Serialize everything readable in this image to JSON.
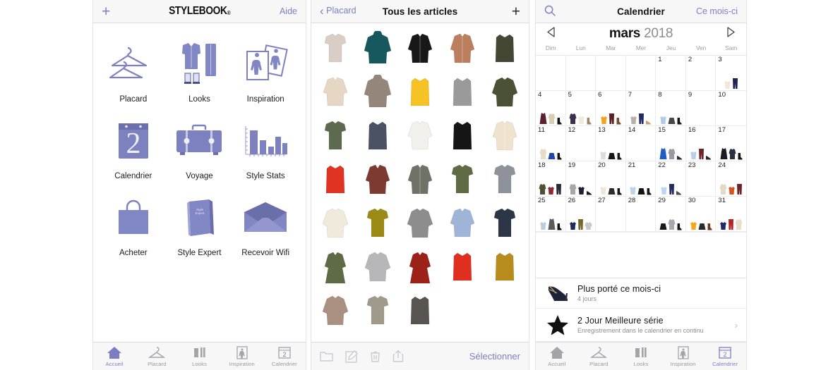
{
  "accent": "#7b7fc2",
  "home_panel": {
    "navbar": {
      "add_icon": "plus-icon",
      "title": "STYLEBOOK",
      "title_mark": "®",
      "help_label": "Aide"
    },
    "tiles": [
      {
        "label": "Placard",
        "icon": "hangers-icon"
      },
      {
        "label": "Looks",
        "icon": "outfit-icon"
      },
      {
        "label": "Inspiration",
        "icon": "photos-icon"
      },
      {
        "label": "Calendrier",
        "icon": "calendar-icon"
      },
      {
        "label": "Voyage",
        "icon": "suitcase-icon"
      },
      {
        "label": "Style Stats",
        "icon": "bar-chart-icon"
      },
      {
        "label": "Acheter",
        "icon": "shopping-bag-icon"
      },
      {
        "label": "Style Expert",
        "icon": "book-icon"
      },
      {
        "label": "Recevoir Wifi",
        "icon": "envelope-icon"
      }
    ],
    "tabbar": {
      "active": "Accueil",
      "items": [
        {
          "label": "Accueil",
          "icon": "home-icon"
        },
        {
          "label": "Placard",
          "icon": "hanger-icon"
        },
        {
          "label": "Looks",
          "icon": "outfit-icon"
        },
        {
          "label": "Inspiration",
          "icon": "inspiration-icon"
        },
        {
          "label": "Calendrier",
          "icon": "calendar-icon"
        }
      ]
    }
  },
  "closet_panel": {
    "navbar": {
      "back_label": "Placard",
      "back_icon": "chevron-left-icon",
      "title": "Tous les articles",
      "add_icon": "plus-icon"
    },
    "items": [
      {
        "type": "tee",
        "color": "#d9cdc6"
      },
      {
        "type": "hoodie",
        "color": "#17585e"
      },
      {
        "type": "cardigan",
        "color": "#181818"
      },
      {
        "type": "cardigan",
        "color": "#bb7f5d"
      },
      {
        "type": "tank",
        "color": "#434734"
      },
      {
        "type": "blouse",
        "color": "#e6d6c4"
      },
      {
        "type": "hoodie",
        "color": "#95867c"
      },
      {
        "type": "tank",
        "color": "#f5c324"
      },
      {
        "type": "tank",
        "color": "#9a9a9a"
      },
      {
        "type": "sweater",
        "color": "#4a5135"
      },
      {
        "type": "tee",
        "color": "#5e6a4f"
      },
      {
        "type": "tank",
        "color": "#4a5263"
      },
      {
        "type": "blouse",
        "color": "#f2f0ea"
      },
      {
        "type": "tank",
        "color": "#151515"
      },
      {
        "type": "cardigan",
        "color": "#efe3cd"
      },
      {
        "type": "tank",
        "color": "#e03322"
      },
      {
        "type": "shirt",
        "color": "#7c3a30"
      },
      {
        "type": "cardigan",
        "color": "#6f7266"
      },
      {
        "type": "tee",
        "color": "#5f6b44"
      },
      {
        "type": "tee",
        "color": "#8e929a"
      },
      {
        "type": "sweater",
        "color": "#efeadc"
      },
      {
        "type": "tee",
        "color": "#9b8a16"
      },
      {
        "type": "sweater",
        "color": "#8d8d8d"
      },
      {
        "type": "blouse",
        "color": "#9fb4d6"
      },
      {
        "type": "tee",
        "color": "#2d3646"
      },
      {
        "type": "dress",
        "color": "#5e6b45"
      },
      {
        "type": "sweater",
        "color": "#b7b7ba"
      },
      {
        "type": "dress",
        "color": "#9c2219"
      },
      {
        "type": "tank",
        "color": "#df2f1f"
      },
      {
        "type": "tank",
        "color": "#b78b1c"
      },
      {
        "type": "sweater",
        "color": "#a99080"
      },
      {
        "type": "tee",
        "color": "#a09a8c"
      },
      {
        "type": "tank",
        "color": "#585450"
      }
    ],
    "toolbar": {
      "icons": [
        "folder-icon",
        "edit-icon",
        "trash-icon",
        "share-icon"
      ],
      "select_label": "Sélectionner"
    }
  },
  "calendar_panel": {
    "navbar": {
      "search_icon": "search-icon",
      "title": "Calendrier",
      "this_month_label": "Ce mois-ci"
    },
    "month": {
      "name": "mars",
      "year": "2018",
      "prev_icon": "triangle-left-icon",
      "next_icon": "triangle-right-icon"
    },
    "weekdays": [
      "Dim",
      "Lun",
      "Mar",
      "Mer",
      "Jeu",
      "Ven",
      "Sam"
    ],
    "lead_blanks": 4,
    "days": [
      {
        "n": "1",
        "outfit": []
      },
      {
        "n": "2",
        "outfit": []
      },
      {
        "n": "3",
        "outfit": [
          {
            "t": "top",
            "c": "#efe8dc"
          },
          {
            "t": "pants",
            "c": "#1d2352"
          }
        ]
      },
      {
        "n": "4",
        "outfit": [
          {
            "t": "dress",
            "c": "#5a2231"
          },
          {
            "t": "coat",
            "c": "#d8cdb6"
          },
          {
            "t": "boot",
            "c": "#111"
          }
        ]
      },
      {
        "n": "5",
        "outfit": [
          {
            "t": "coat",
            "c": "#3a3148"
          },
          {
            "t": "top",
            "c": "#efeadd"
          },
          {
            "t": "boot",
            "c": "#9d8468"
          }
        ]
      },
      {
        "n": "6",
        "outfit": [
          {
            "t": "top",
            "c": "#f2a41f"
          },
          {
            "t": "pants",
            "c": "#5c1f23"
          },
          {
            "t": "boot",
            "c": "#7a4a2a"
          }
        ]
      },
      {
        "n": "7",
        "outfit": [
          {
            "t": "top",
            "c": "#b9b2a4"
          },
          {
            "t": "pants",
            "c": "#212a63"
          },
          {
            "t": "shoe",
            "c": "#c9a26a"
          }
        ]
      },
      {
        "n": "8",
        "outfit": [
          {
            "t": "top",
            "c": "#b3cbe6"
          },
          {
            "t": "skirt",
            "c": "#4a4742"
          },
          {
            "t": "boot",
            "c": "#141414"
          }
        ]
      },
      {
        "n": "9",
        "outfit": []
      },
      {
        "n": "10",
        "outfit": []
      },
      {
        "n": "11",
        "outfit": [
          {
            "t": "coat",
            "c": "#e7dcc8"
          },
          {
            "t": "skirt",
            "c": "#1f47a8"
          },
          {
            "t": "boot",
            "c": "#141414"
          }
        ]
      },
      {
        "n": "12",
        "outfit": []
      },
      {
        "n": "13",
        "outfit": [
          {
            "t": "top",
            "c": "#ddddd8"
          },
          {
            "t": "skirt",
            "c": "#171717"
          },
          {
            "t": "boot",
            "c": "#1a1a1a"
          }
        ]
      },
      {
        "n": "14",
        "outfit": []
      },
      {
        "n": "15",
        "outfit": [
          {
            "t": "dress",
            "c": "#1f5fc4"
          },
          {
            "t": "coat",
            "c": "#9a9aa0"
          },
          {
            "t": "shoe",
            "c": "#2a2a3a"
          }
        ]
      },
      {
        "n": "16",
        "outfit": [
          {
            "t": "top",
            "c": "#b9cfe8"
          },
          {
            "t": "pants",
            "c": "#6d2329"
          },
          {
            "t": "shoe",
            "c": "#262626"
          }
        ]
      },
      {
        "n": "17",
        "outfit": [
          {
            "t": "dress",
            "c": "#1b1b22"
          },
          {
            "t": "coat",
            "c": "#2a3040"
          },
          {
            "t": "boot",
            "c": "#141414"
          }
        ]
      },
      {
        "n": "18",
        "outfit": [
          {
            "t": "coat",
            "c": "#4d5134"
          },
          {
            "t": "top",
            "c": "#8c2b35"
          },
          {
            "t": "pants",
            "c": "#262a33"
          }
        ]
      },
      {
        "n": "19",
        "outfit": [
          {
            "t": "coat",
            "c": "#a7a7ab"
          },
          {
            "t": "top",
            "c": "#1e2233"
          },
          {
            "t": "shoe",
            "c": "#1b1b1b"
          }
        ]
      },
      {
        "n": "20",
        "outfit": [
          {
            "t": "top",
            "c": "#eee6d6"
          },
          {
            "t": "skirt",
            "c": "#2c2c2c"
          },
          {
            "t": "boot",
            "c": "#151515"
          }
        ]
      },
      {
        "n": "21",
        "outfit": [
          {
            "t": "top",
            "c": "#bdd3ea"
          },
          {
            "t": "skirt",
            "c": "#151515"
          },
          {
            "t": "boot",
            "c": "#141414"
          }
        ]
      },
      {
        "n": "22",
        "outfit": [
          {
            "t": "top",
            "c": "#c0d6ee"
          },
          {
            "t": "pants",
            "c": "#242a62"
          },
          {
            "t": "shoe",
            "c": "#4b4b4b"
          }
        ]
      },
      {
        "n": "23",
        "outfit": []
      },
      {
        "n": "24",
        "outfit": [
          {
            "t": "coat",
            "c": "#e4dac3"
          },
          {
            "t": "top",
            "c": "#d6521e"
          },
          {
            "t": "pants",
            "c": "#6b2327"
          }
        ]
      },
      {
        "n": "25",
        "outfit": [
          {
            "t": "top",
            "c": "#b9cde2"
          },
          {
            "t": "dress",
            "c": "#5a5a5f"
          },
          {
            "t": "boot",
            "c": "#121212"
          }
        ]
      },
      {
        "n": "26",
        "outfit": [
          {
            "t": "top",
            "c": "#1b2a63"
          },
          {
            "t": "pants",
            "c": "#756727"
          },
          {
            "t": "sweater",
            "c": "#c9c9cc"
          }
        ]
      },
      {
        "n": "27",
        "outfit": []
      },
      {
        "n": "28",
        "outfit": []
      },
      {
        "n": "29",
        "outfit": [
          {
            "t": "skirt",
            "c": "#1a1a1a"
          },
          {
            "t": "coat",
            "c": "#a9a9ae"
          },
          {
            "t": "boot",
            "c": "#151515"
          }
        ]
      },
      {
        "n": "30",
        "outfit": [
          {
            "t": "top",
            "c": "#f2a81f"
          },
          {
            "t": "skirt",
            "c": "#2a2a2a"
          },
          {
            "t": "boot",
            "c": "#6b3b20"
          }
        ]
      },
      {
        "n": "31",
        "outfit": [
          {
            "t": "top",
            "c": "#1d2a63"
          },
          {
            "t": "pants",
            "c": "#b22222"
          },
          {
            "t": "coat",
            "c": "#e7ddc9"
          }
        ]
      }
    ],
    "stats": [
      {
        "icon": "heel-shoe-icon",
        "title": "Plus porté ce mois-ci",
        "sub": "4 jours",
        "chevron": false
      },
      {
        "icon": "star-icon",
        "title": "2 Jour Meilleure série",
        "sub": "Enregistrement dans le calendrier en continu",
        "chevron": true
      }
    ],
    "tabbar": {
      "active": "Calendrier",
      "items": [
        {
          "label": "Accueil",
          "icon": "home-icon"
        },
        {
          "label": "Placard",
          "icon": "hanger-icon"
        },
        {
          "label": "Looks",
          "icon": "outfit-icon"
        },
        {
          "label": "Inspiration",
          "icon": "inspiration-icon"
        },
        {
          "label": "Calendrier",
          "icon": "calendar-icon"
        }
      ]
    }
  }
}
